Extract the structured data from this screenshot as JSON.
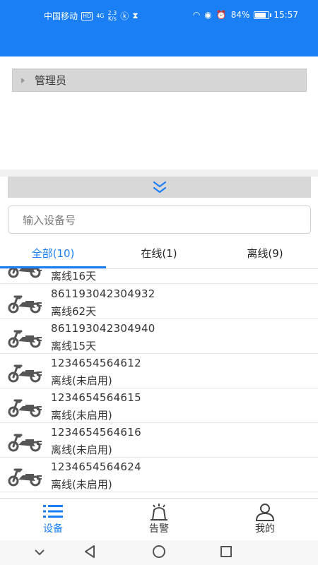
{
  "status_bar": {
    "carrier": "中国移动",
    "hd": "HD",
    "network": "4G",
    "speed_top": "2.3",
    "speed_bottom": "K/s",
    "battery": "84%",
    "time": "15:57"
  },
  "tree": {
    "root_label": "管理员"
  },
  "search": {
    "placeholder": "输入设备号"
  },
  "tabs": [
    {
      "label": "全部(10)",
      "active": true
    },
    {
      "label": "在线(1)",
      "active": false
    },
    {
      "label": "离线(9)",
      "active": false
    }
  ],
  "devices": [
    {
      "id": "",
      "status": "离线16天"
    },
    {
      "id": "861193042304932",
      "status": "离线62天"
    },
    {
      "id": "861193042304940",
      "status": "离线15天"
    },
    {
      "id": "1234654564612",
      "status": "离线(未启用)"
    },
    {
      "id": "1234654564615",
      "status": "离线(未启用)"
    },
    {
      "id": "1234654564616",
      "status": "离线(未启用)"
    },
    {
      "id": "1234654564624",
      "status": "离线(未启用)"
    }
  ],
  "bottom_nav": [
    {
      "label": "设备",
      "icon": "list-icon",
      "active": true
    },
    {
      "label": "告警",
      "icon": "alarm-icon",
      "active": false
    },
    {
      "label": "我的",
      "icon": "user-icon",
      "active": false
    }
  ],
  "colors": {
    "accent": "#1a7ff5"
  }
}
